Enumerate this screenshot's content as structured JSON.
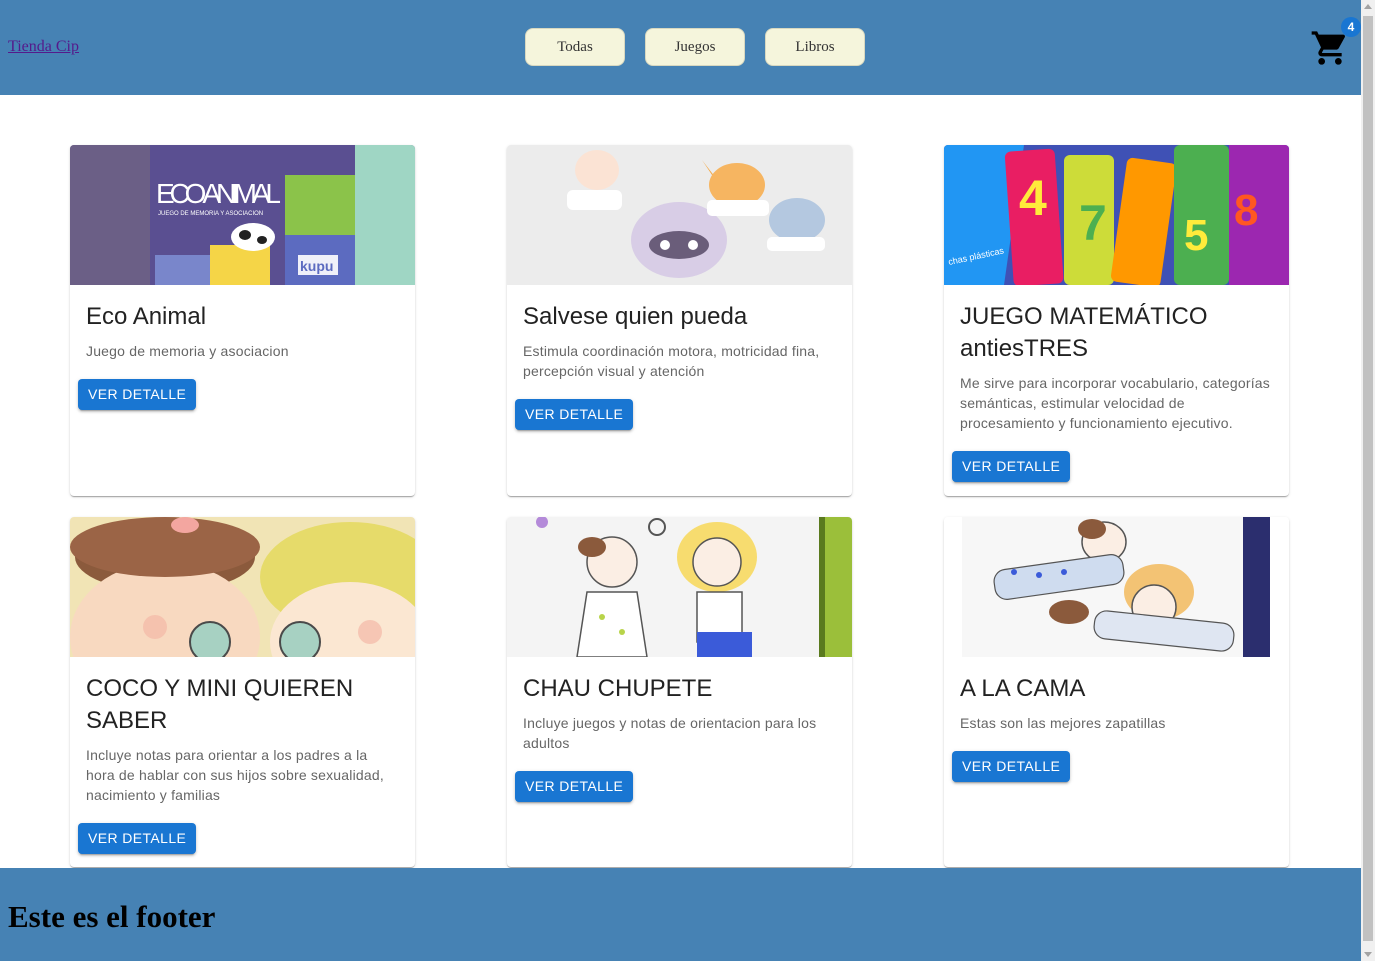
{
  "header": {
    "brand": "Tienda Cip",
    "nav": [
      "Todas",
      "Juegos",
      "Libros"
    ],
    "cart_icon": "shopping-cart-icon",
    "cart_count": "4"
  },
  "products": [
    {
      "title": "Eco Animal",
      "description": "Juego de memoria y asociacion",
      "button": "VER DETALLE"
    },
    {
      "title": "Salvese quien pueda",
      "description": "Estimula coordinación motora, motricidad fina, percepción visual y atención",
      "button": "VER DETALLE"
    },
    {
      "title": "JUEGO MATEMÁTICO antiesTRES",
      "description": "Me sirve para incorporar vocabulario, categorías semánticas, estimular velocidad de procesamiento y funcionamiento ejecutivo.",
      "button": "VER DETALLE"
    },
    {
      "title": "COCO Y MINI QUIEREN SABER",
      "description": "Incluye notas para orientar a los padres a la hora de hablar con sus hijos sobre sexualidad, nacimiento y familias",
      "button": "VER DETALLE"
    },
    {
      "title": "CHAU CHUPETE",
      "description": "Incluye juegos y notas de orientacion para los adultos",
      "button": "VER DETALLE"
    },
    {
      "title": "A LA CAMA",
      "description": "Estas son las mejores zapatillas",
      "button": "VER DETALLE"
    }
  ],
  "footer": {
    "text": "Este es el footer"
  },
  "colors": {
    "header_bg": "#4682b4",
    "nav_button_bg": "#f5f5dc",
    "primary": "#1976d2"
  }
}
